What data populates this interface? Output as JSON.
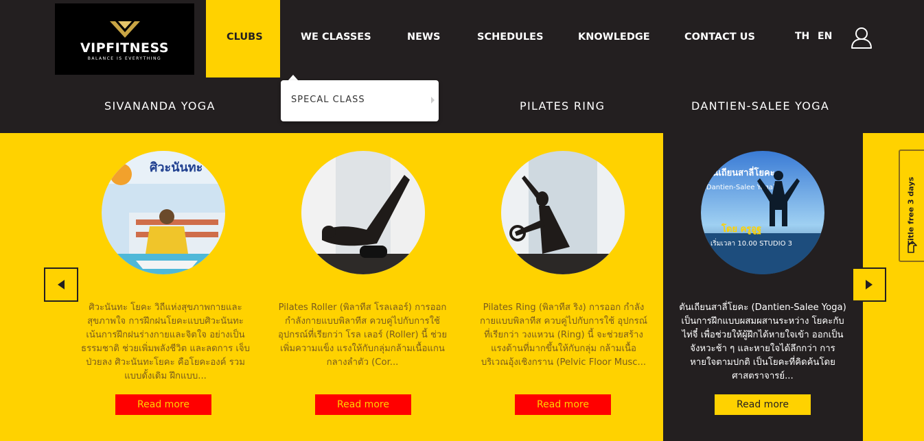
{
  "brand": {
    "name": "VIPFITNESS",
    "tagline": "BALANCE IS EVERYTHING"
  },
  "nav": {
    "items": [
      "CLUBS",
      "WE CLASSES",
      "NEWS",
      "SCHEDULES",
      "KNOWLEDGE",
      "CONTACT US"
    ],
    "active": "CLUBS",
    "lang_th": "TH",
    "lang_en": "EN"
  },
  "submenu": {
    "items": [
      "SIVANANDA YOGA",
      "PILATES RING",
      "DANTIEN-SALEE YOGA"
    ],
    "dropdown_item": "SPECAL CLASS"
  },
  "cards": [
    {
      "text": "ศิวะนันทะ โยคะ วิถีแห่งสุขภาพกายและ สุขภาพใจ การฝึกฝนโยคะแบบศิวะนันทะ เน้นการฝึกฝนร่างกายและจิตใจ อย่างเป็น ธรรมชาติ ช่วยเพิ่มพลังชีวิต และลดการ เจ็บป่วยลง ศิวะนันทะโยคะ คือโยคะองค์ รวมแบบดั้งเดิม ฝึกแบบ...",
      "button": "Read more"
    },
    {
      "text": "Pilates Roller (พิลาทีส โรลเลอร์) การออกกำลังกายแบบพิลาทีส ควบคู่ไปกับการใช้อุปกรณ์ที่เรียกว่า โรล เลอร์ (Roller) นี้ ช่วยเพิ่มความแข็ง แรงให้กับกลุ่มกล้ามเนื้อแกนกลางลำตัว (Cor...",
      "button": "Read more"
    },
    {
      "text": "Pilates Ring (พิลาทีส ริง) การออก กำลังกายแบบพิลาทีส ควบคู่ไปกับการใช้ อุปกรณ์ที่เรียกว่า วงแหวน (Ring) นี้ จะช่วยสร้างแรงต้านที่มากขึ้นให้กับกลุ่ม กล้ามเนื้อบริเวณอุ้งเชิงกราน (Pelvic Floor Musc...",
      "button": "Read more"
    },
    {
      "text": "ตันเถียนสาลี่โยคะ (Dantien-Salee Yoga) เป็นการฝึกแบบผสมผสานระหว่าง โยคะกับไท่จี๋ เพื่อช่วยให้ผู้ฝึกได้หายใจเข้า ออกเป็นจังหวะช้า ๆ และหายใจได้ลึกกว่า การหายใจตามปกติ เป็นโยคะที่คิดค้นโดย ศาสตราจารย์...",
      "button": "Read more"
    }
  ],
  "card_images": {
    "sivananda_title": "ศิวะนันทะ โยคะ",
    "dantien_title": "ตันเถียนสาลี่โยคะ",
    "dantien_sub": "(Dantien-Salee Yoga)",
    "dantien_teacher": "โดย ครูอูฐ",
    "dantien_time": "เริ่มเวลา 10.00 STUDIO 3"
  },
  "trial_tab": "Title free 3 days",
  "colors": {
    "yellow": "#ffd200",
    "dark": "#231f20",
    "red": "#ff0000"
  }
}
